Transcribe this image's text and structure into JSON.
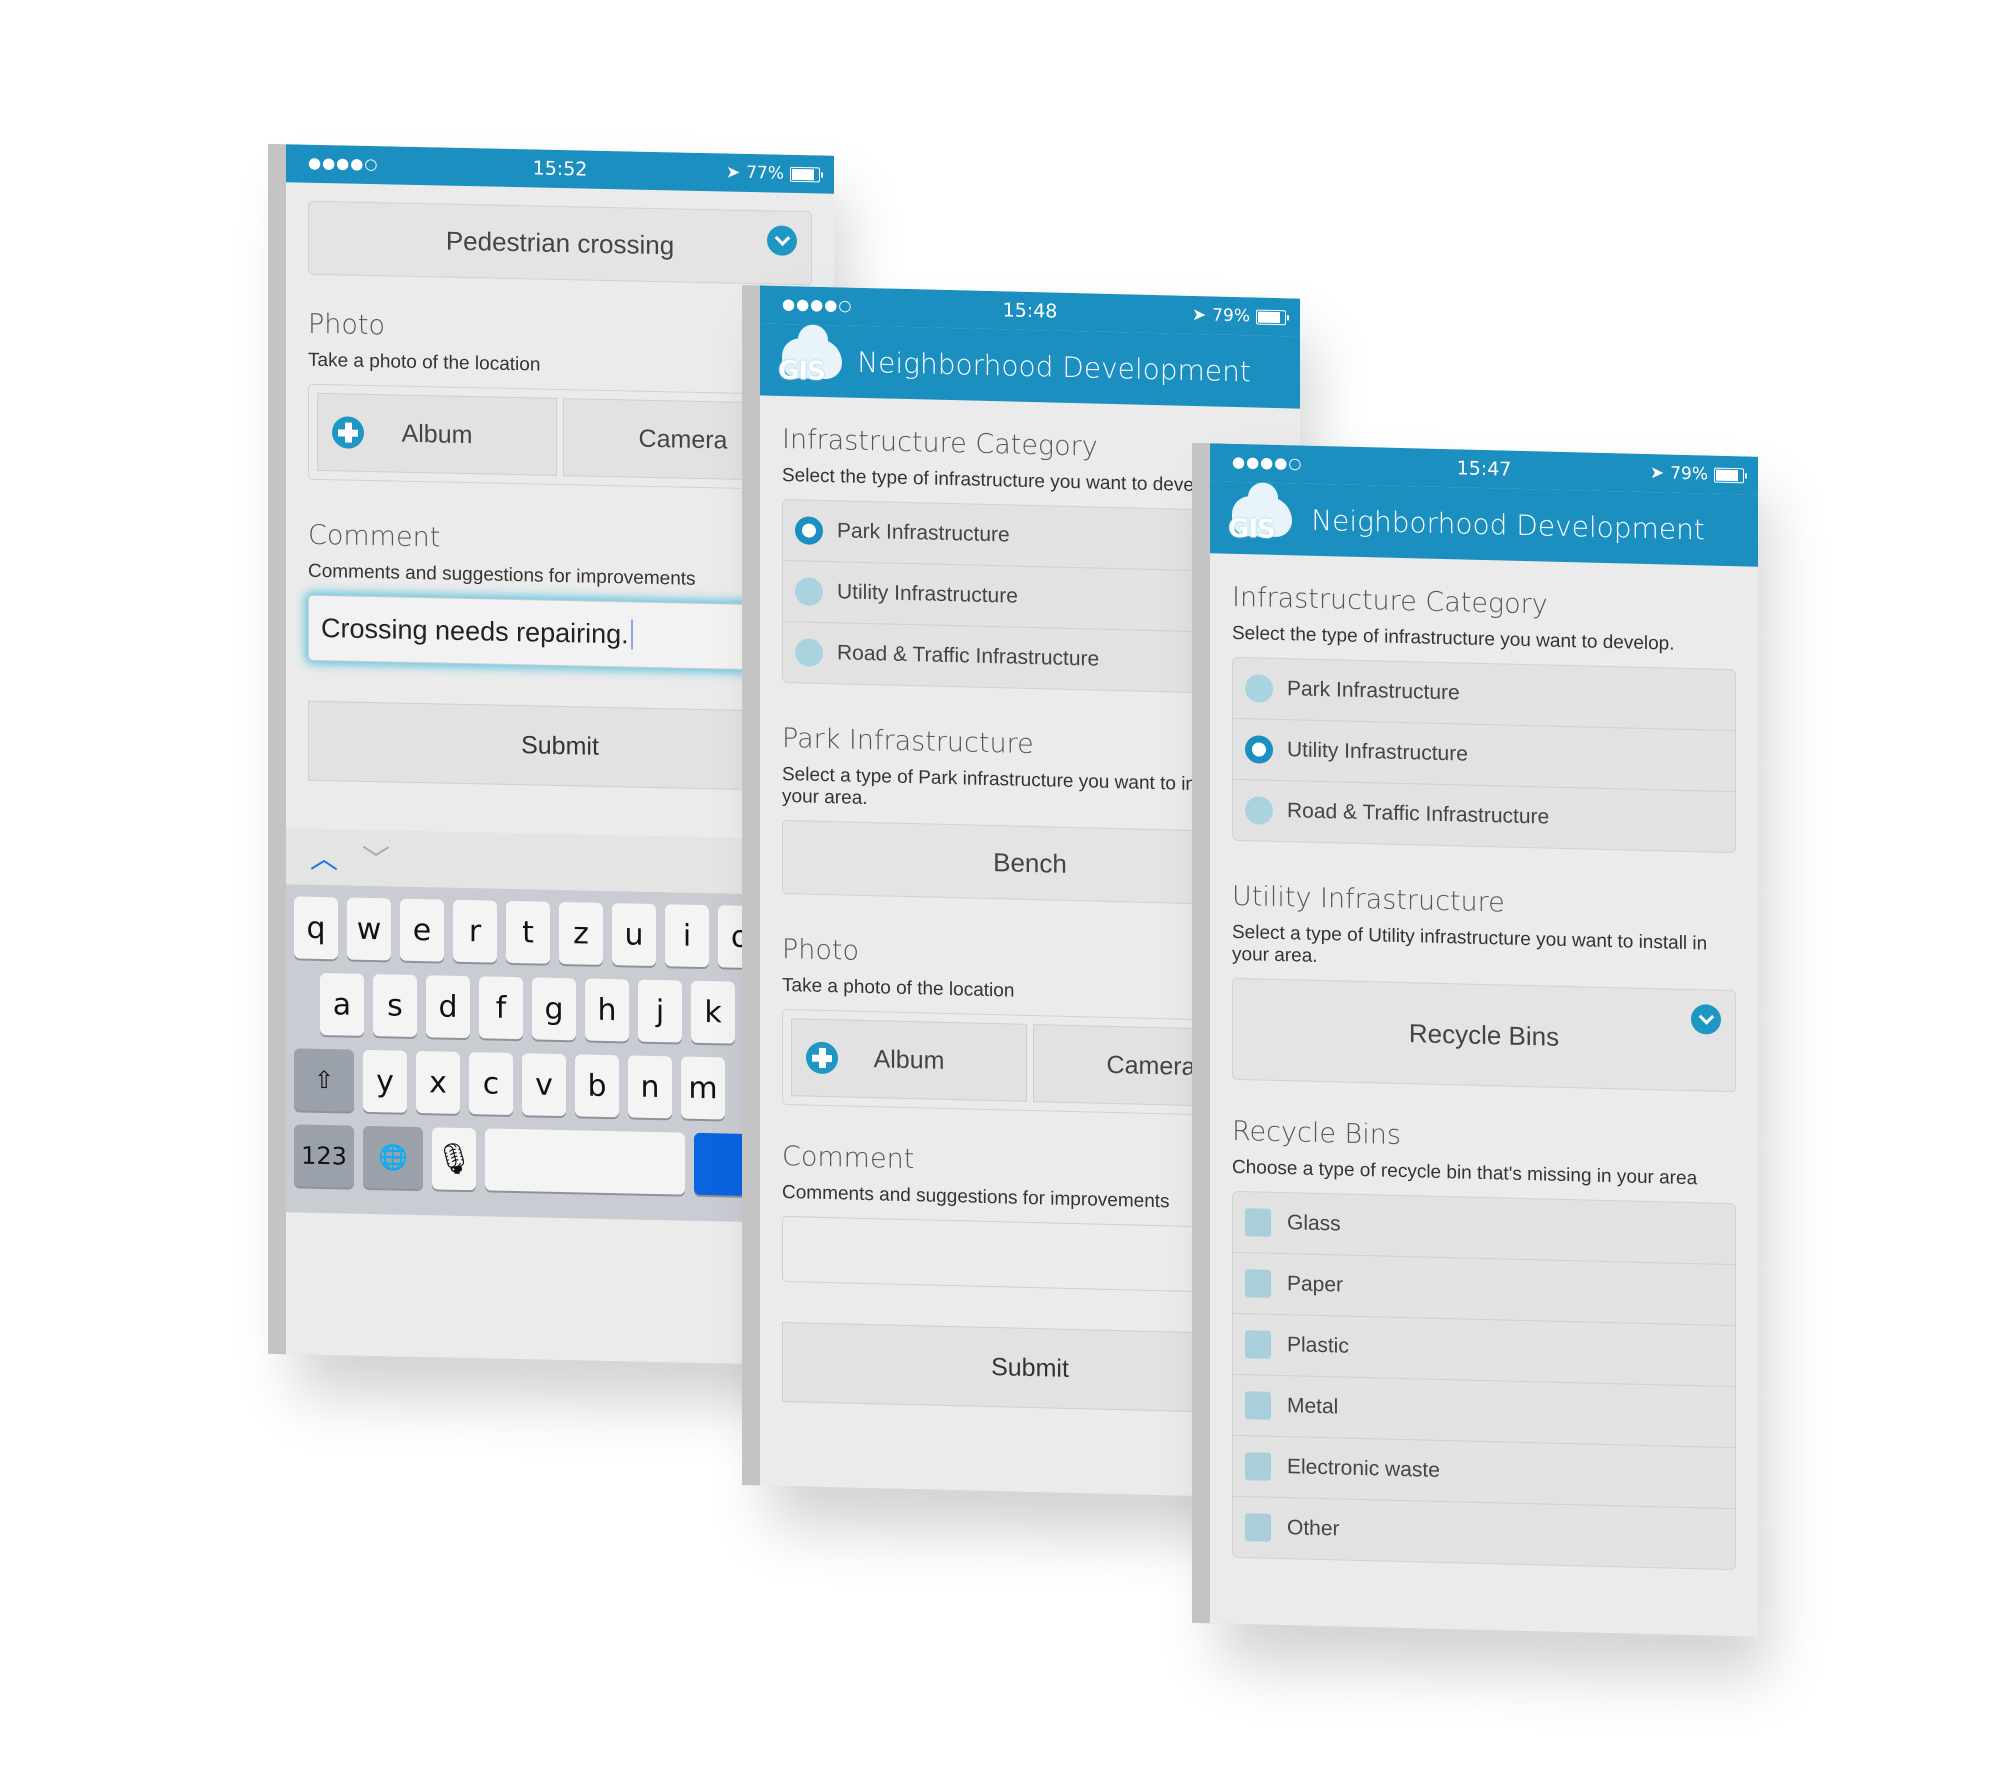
{
  "phones": [
    {
      "status": {
        "signal": "●●●●○",
        "time": "15:52",
        "battery": "77%",
        "battery_level": 0.77
      },
      "top_select": {
        "value": "Pedestrian crossing"
      },
      "photo": {
        "label": "Photo",
        "hint": "Take a photo of the location",
        "album": "Album",
        "camera": "Camera"
      },
      "comment": {
        "label": "Comment",
        "hint": "Comments and suggestions for improvements",
        "value": "Crossing needs repairing."
      },
      "submit": "Submit",
      "keyboard": {
        "row1": [
          "q",
          "w",
          "e",
          "r",
          "t",
          "z",
          "u",
          "i",
          "o"
        ],
        "row2": [
          "a",
          "s",
          "d",
          "f",
          "g",
          "h",
          "j",
          "k"
        ],
        "row3": [
          "y",
          "x",
          "c",
          "v",
          "b",
          "n",
          "m"
        ],
        "num_key": "123",
        "shift_icon": "⇧",
        "globe_icon": "🌐",
        "mic_icon": "🎙",
        "up_icon": "︿",
        "down_icon": "﹀"
      }
    },
    {
      "status": {
        "signal": "●●●●○",
        "time": "15:48",
        "battery": "79%",
        "battery_level": 0.79
      },
      "app_title": "Neighborhood Development",
      "logo": "GIS",
      "category": {
        "label": "Infrastructure Category",
        "hint": "Select the type of infrastructure you want to develop.",
        "options": [
          "Park Infrastructure",
          "Utility Infrastructure",
          "Road & Traffic Infrastructure"
        ],
        "selected": 0
      },
      "sub": {
        "label": "Park Infrastructure",
        "hint": "Select a type of Park infrastructure you want to install in your area.",
        "value": "Bench"
      },
      "photo": {
        "label": "Photo",
        "hint": "Take a photo of the location",
        "album": "Album",
        "camera": "Camera"
      },
      "comment": {
        "label": "Comment",
        "hint": "Comments and suggestions for improvements",
        "value": ""
      },
      "submit": "Submit"
    },
    {
      "status": {
        "signal": "●●●●○",
        "time": "15:47",
        "battery": "79%",
        "battery_level": 0.79
      },
      "app_title": "Neighborhood Development",
      "logo": "GIS",
      "category": {
        "label": "Infrastructure Category",
        "hint": "Select the type of infrastructure you want to develop.",
        "options": [
          "Park Infrastructure",
          "Utility Infrastructure",
          "Road & Traffic Infrastructure"
        ],
        "selected": 1
      },
      "sub": {
        "label": "Utility Infrastructure",
        "hint": "Select a type of Utility infrastructure you want to install in your area.",
        "value": "Recycle Bins"
      },
      "bins": {
        "label": "Recycle Bins",
        "hint": "Choose a type of recycle bin that's missing in your area",
        "options": [
          "Glass",
          "Paper",
          "Plastic",
          "Metal",
          "Electronic waste",
          "Other"
        ]
      }
    }
  ],
  "colors": {
    "brand": "#1a8fc0",
    "radio_off": "#a9d3df",
    "keyboard_go": "#0a64e0"
  }
}
